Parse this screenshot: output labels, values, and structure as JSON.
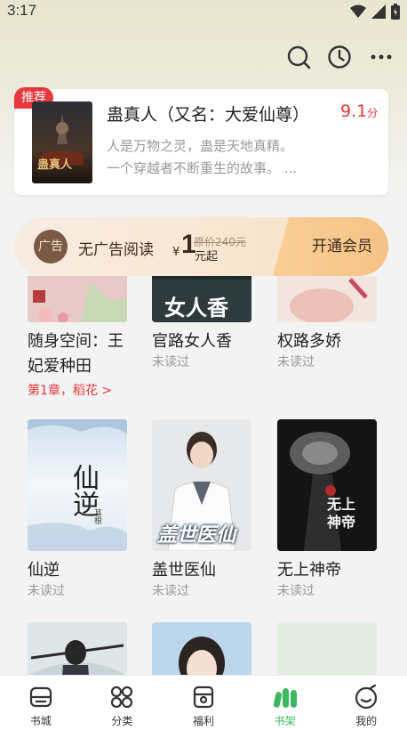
{
  "status_bar": {
    "time": "3:17"
  },
  "recommend": {
    "badge": "推荐",
    "title": "蛊真人（又名：大爱仙尊）",
    "score": "9.1",
    "score_unit": "分",
    "desc_line1": "人是万物之灵，蛊是天地真精。",
    "desc_line2": "一个穿越者不断重生的故事。 ...",
    "cover_text": "蛊真人"
  },
  "vip": {
    "ad_icon_text": "广告",
    "label": "无广告阅读",
    "currency": "¥",
    "price": "1",
    "price_suffix": "元起",
    "original_price": "原价240元",
    "button": "开通会员"
  },
  "shelf": [
    {
      "title": "随身空间：王妃爱种田",
      "status": "",
      "progress": "第1章，稻花 >"
    },
    {
      "title": "官路女人香",
      "status": "未读过",
      "cover_text": "女人香"
    },
    {
      "title": "权路多娇",
      "status": "未读过"
    },
    {
      "title": "仙逆",
      "status": "未读过",
      "cover_text": "仙逆",
      "cover_sub": "耳根"
    },
    {
      "title": "盖世医仙",
      "status": "未读过",
      "cover_text": "盖世医仙"
    },
    {
      "title": "无上神帝",
      "status": "未读过",
      "cover_text": "无上神帝"
    }
  ],
  "bottom_nav": [
    {
      "label": "书城",
      "icon": "bookstore-icon"
    },
    {
      "label": "分类",
      "icon": "category-icon"
    },
    {
      "label": "福利",
      "icon": "welfare-icon"
    },
    {
      "label": "书架",
      "icon": "bookshelf-icon",
      "active": true
    },
    {
      "label": "我的",
      "icon": "profile-icon"
    }
  ],
  "colors": {
    "accent_red": "#e8383d",
    "accent_green": "#3db860"
  }
}
